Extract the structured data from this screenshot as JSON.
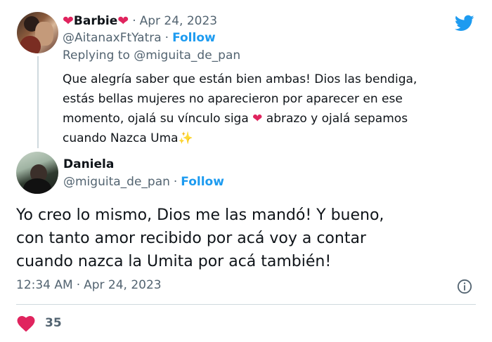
{
  "tweet1": {
    "name_prefix_emoji": "❤",
    "name": "Barbie",
    "name_suffix_emoji": "❤",
    "separator": "·",
    "date": "Apr 24, 2023",
    "handle": "@AitanaxFtYatra",
    "follow_label": "Follow",
    "replying_to": "Replying to @miguita_de_pan",
    "body_line1": "Que alegría saber que están bien ambas! Dios las bendiga,",
    "body_line2": "estás bellas mujeres no aparecieron por aparecer en ese",
    "body_line3a": "momento, ojalá su vínculo siga ",
    "body_heart": "❤",
    "body_line3b": " abrazo y ojalá sepamos",
    "body_line4": "cuando Nazca Uma",
    "body_sparkle": "✨"
  },
  "tweet2": {
    "name": "Daniela",
    "handle": "@miguita_de_pan",
    "separator": "·",
    "follow_label": "Follow",
    "body_line1": "Yo creo lo mismo, Dios me las mandó! Y bueno,",
    "body_line2": "con tanto amor recibido por acá voy a contar",
    "body_line3": "cuando nazca la Umita por acá también!",
    "time": "12:34 AM",
    "separator2": "·",
    "date": "Apr 24, 2023",
    "likes": "35"
  },
  "colors": {
    "accent": "#1d9bf0",
    "heart": "#e0245e",
    "muted": "#536471"
  },
  "icons": [
    "twitter-bird-icon",
    "info-icon",
    "heart-icon"
  ]
}
